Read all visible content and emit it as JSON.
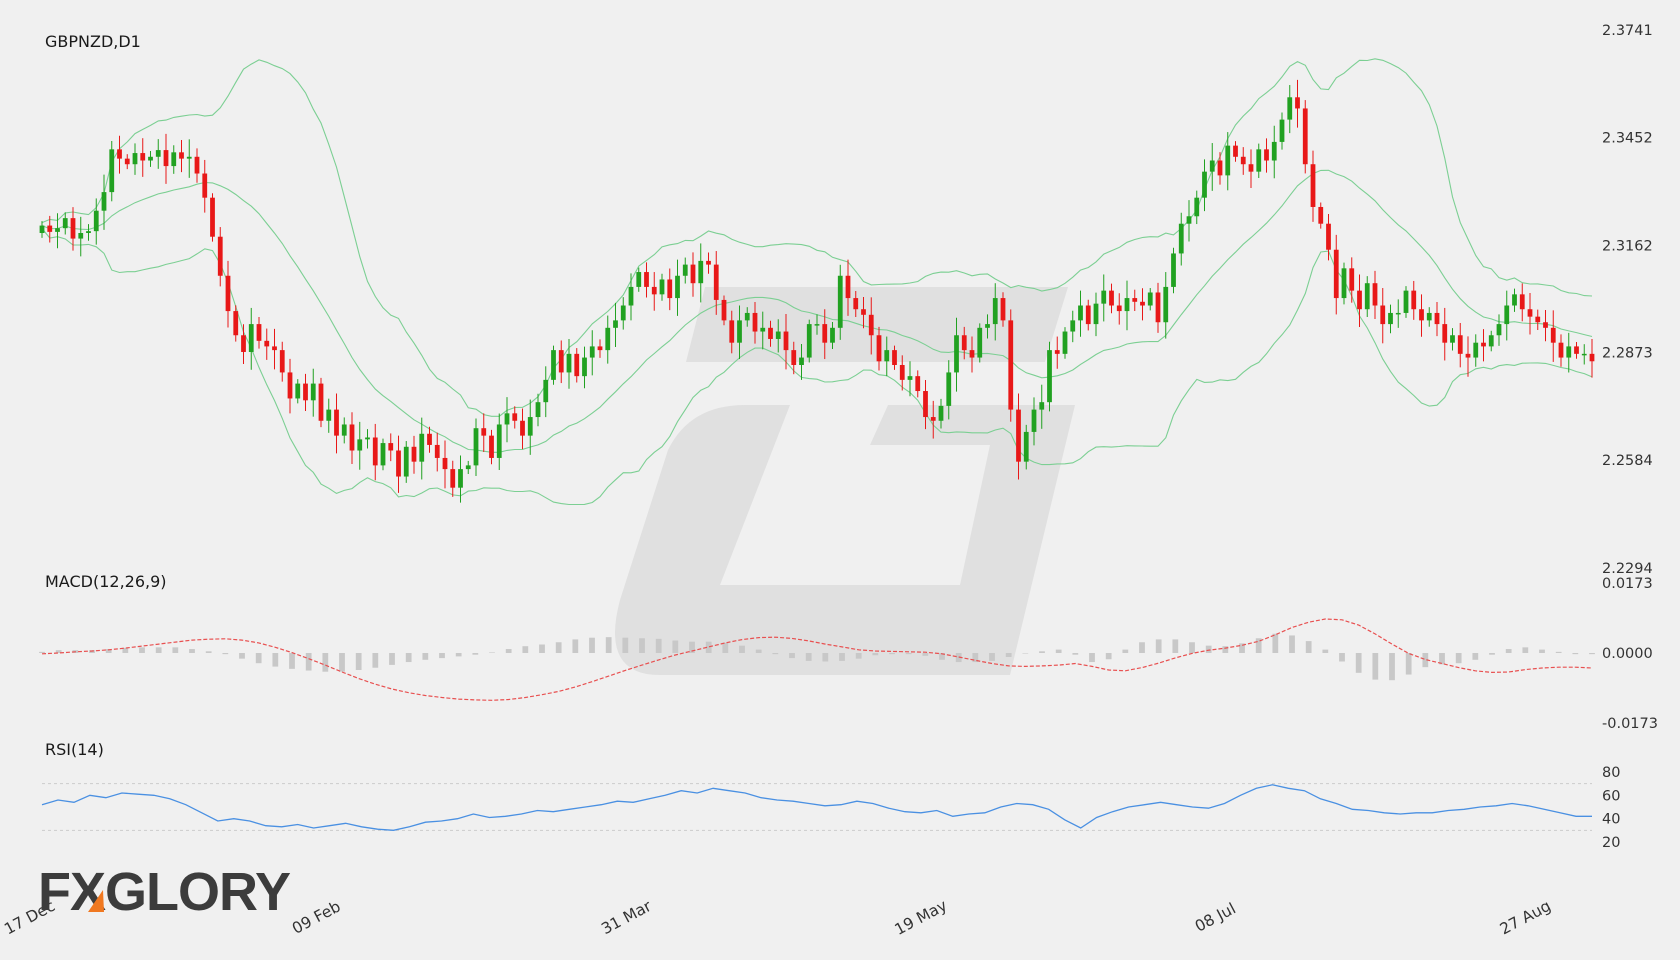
{
  "chart_data": [
    {
      "type": "candlestick",
      "title": "GBPNZD,D1",
      "y_ticks": [
        "2.3741",
        "2.3452",
        "2.3162",
        "2.2873",
        "2.2584",
        "2.2294"
      ],
      "ylim": [
        2.2294,
        2.3741
      ],
      "x_ticks": [
        "17 Dec",
        "09 Feb",
        "31 Mar",
        "19 May",
        "08 Jul",
        "27 Aug"
      ],
      "colors": {
        "up": "#21a121",
        "down": "#e81818",
        "bands": "#7ccf93"
      },
      "indicator": "Bollinger Bands",
      "close": [
        2.3215,
        2.3198,
        2.3208,
        2.3235,
        2.318,
        2.3195,
        2.32,
        2.3255,
        2.3305,
        2.342,
        2.3395,
        2.338,
        2.341,
        2.339,
        2.34,
        2.3418,
        2.3375,
        2.3412,
        2.3395,
        2.34,
        2.3355,
        2.329,
        2.3185,
        2.308,
        2.2985,
        2.292,
        2.2875,
        2.295,
        2.2905,
        2.289,
        2.288,
        2.282,
        2.275,
        2.279,
        2.2745,
        2.279,
        2.269,
        2.272,
        2.265,
        2.268,
        2.261,
        2.264,
        2.2645,
        2.257,
        2.263,
        2.261,
        2.254,
        2.262,
        2.258,
        2.2655,
        2.2625,
        2.259,
        2.256,
        2.251,
        2.256,
        2.257,
        2.267,
        2.265,
        2.259,
        2.268,
        2.271,
        2.269,
        2.265,
        2.27,
        2.274,
        2.28,
        2.288,
        2.282,
        2.287,
        2.281,
        2.286,
        2.289,
        2.288,
        2.294,
        2.296,
        2.3,
        2.305,
        2.309,
        2.305,
        2.303,
        2.307,
        2.302,
        2.308,
        2.311,
        2.306,
        2.312,
        2.311,
        2.3015,
        2.296,
        2.29,
        2.296,
        2.298,
        2.293,
        2.294,
        2.291,
        2.293,
        2.288,
        2.284,
        2.286,
        2.295,
        2.295,
        2.29,
        2.294,
        2.308,
        2.302,
        2.299,
        2.2975,
        2.292,
        2.285,
        2.288,
        2.284,
        2.28,
        2.281,
        2.277,
        2.27,
        2.269,
        2.273,
        2.282,
        2.292,
        2.288,
        2.286,
        2.294,
        2.295,
        2.302,
        2.296,
        2.272,
        2.258,
        2.266,
        2.272,
        2.274,
        2.288,
        2.287,
        2.293,
        2.296,
        2.3,
        2.295,
        2.3005,
        2.304,
        2.3,
        2.2985,
        2.302,
        2.301,
        2.3,
        2.3035,
        2.2955,
        2.305,
        2.314,
        2.322,
        2.324,
        2.329,
        2.336,
        2.339,
        2.335,
        2.343,
        2.34,
        2.338,
        2.336,
        2.342,
        2.339,
        2.344,
        2.35,
        2.356,
        2.353,
        2.338,
        2.3265,
        2.322,
        2.315,
        2.302,
        2.31,
        2.304,
        2.299,
        2.306,
        2.3,
        2.295,
        2.298,
        2.298,
        2.304,
        2.299,
        2.296,
        2.298,
        2.295,
        2.29,
        2.292,
        2.287,
        2.286,
        2.29,
        2.289,
        2.292,
        2.295,
        2.3,
        2.303,
        2.299,
        2.297,
        2.2955,
        2.294,
        2.29,
        2.286,
        2.289,
        2.287,
        2.287,
        2.285
      ]
    },
    {
      "type": "histogram+line",
      "title": "MACD(12,26,9)",
      "y_ticks": [
        "0.0173",
        "0.0000",
        "-0.0173"
      ],
      "ylim": [
        -0.0173,
        0.0173
      ],
      "colors": {
        "histogram": "#c8c8c8",
        "signal": "#e85050"
      },
      "signal": [
        -0.0002,
        0.0,
        0.0003,
        0.0005,
        0.0008,
        0.0012,
        0.0017,
        0.0022,
        0.0027,
        0.0032,
        0.0034,
        0.0035,
        0.0032,
        0.0025,
        0.0014,
        0.0001,
        -0.0014,
        -0.003,
        -0.0047,
        -0.0063,
        -0.0077,
        -0.0089,
        -0.0098,
        -0.0105,
        -0.011,
        -0.0114,
        -0.0116,
        -0.0117,
        -0.0115,
        -0.011,
        -0.0103,
        -0.0095,
        -0.0084,
        -0.0071,
        -0.0057,
        -0.0043,
        -0.003,
        -0.0017,
        -0.0005,
        0.0005,
        0.0015,
        0.0025,
        0.0033,
        0.0038,
        0.0039,
        0.0036,
        0.003,
        0.0022,
        0.0015,
        0.0008,
        0.0005,
        0.0004,
        0.0003,
        0.0002,
        -0.0002,
        -0.001,
        -0.0018,
        -0.0026,
        -0.0032,
        -0.0033,
        -0.0032,
        -0.003,
        -0.0026,
        -0.0033,
        -0.0042,
        -0.0044,
        -0.0036,
        -0.0025,
        -0.0012,
        -0.0001,
        0.0007,
        0.0012,
        0.0019,
        0.0029,
        0.0045,
        0.0063,
        0.0076,
        0.0084,
        0.0082,
        0.0069,
        0.0047,
        0.0022,
        -0.0001,
        -0.0016,
        -0.0026,
        -0.0036,
        -0.0044,
        -0.0048,
        -0.0047,
        -0.0041,
        -0.0037,
        -0.0035,
        -0.0035,
        -0.0037
      ]
    },
    {
      "type": "line",
      "title": "RSI(14)",
      "y_ticks": [
        "80",
        "60",
        "40",
        "20"
      ],
      "ylim": [
        20,
        80
      ],
      "levels": [
        70,
        30
      ],
      "colors": {
        "line": "#4a90e2",
        "levels": "#cccccc"
      },
      "values": [
        52,
        56,
        54,
        60,
        58,
        62,
        61,
        60,
        57,
        52,
        45,
        38,
        40,
        38,
        34,
        33,
        35,
        32,
        34,
        36,
        33,
        31,
        30,
        33,
        37,
        38,
        40,
        44,
        41,
        42,
        44,
        47,
        46,
        48,
        50,
        52,
        55,
        54,
        57,
        60,
        64,
        62,
        66,
        64,
        62,
        58,
        56,
        55,
        53,
        51,
        52,
        55,
        53,
        49,
        46,
        45,
        47,
        42,
        44,
        45,
        50,
        53,
        52,
        48,
        39,
        32,
        41,
        46,
        50,
        52,
        54,
        52,
        50,
        49,
        53,
        60,
        66,
        69,
        66,
        64,
        57,
        53,
        48,
        47,
        45,
        44,
        45,
        45,
        47,
        48,
        50,
        51,
        53,
        51,
        48,
        45,
        42,
        42
      ]
    }
  ],
  "watermark_text": "FXGLORY",
  "icons": [
    "fxglory-logo",
    "watermark-logo"
  ]
}
